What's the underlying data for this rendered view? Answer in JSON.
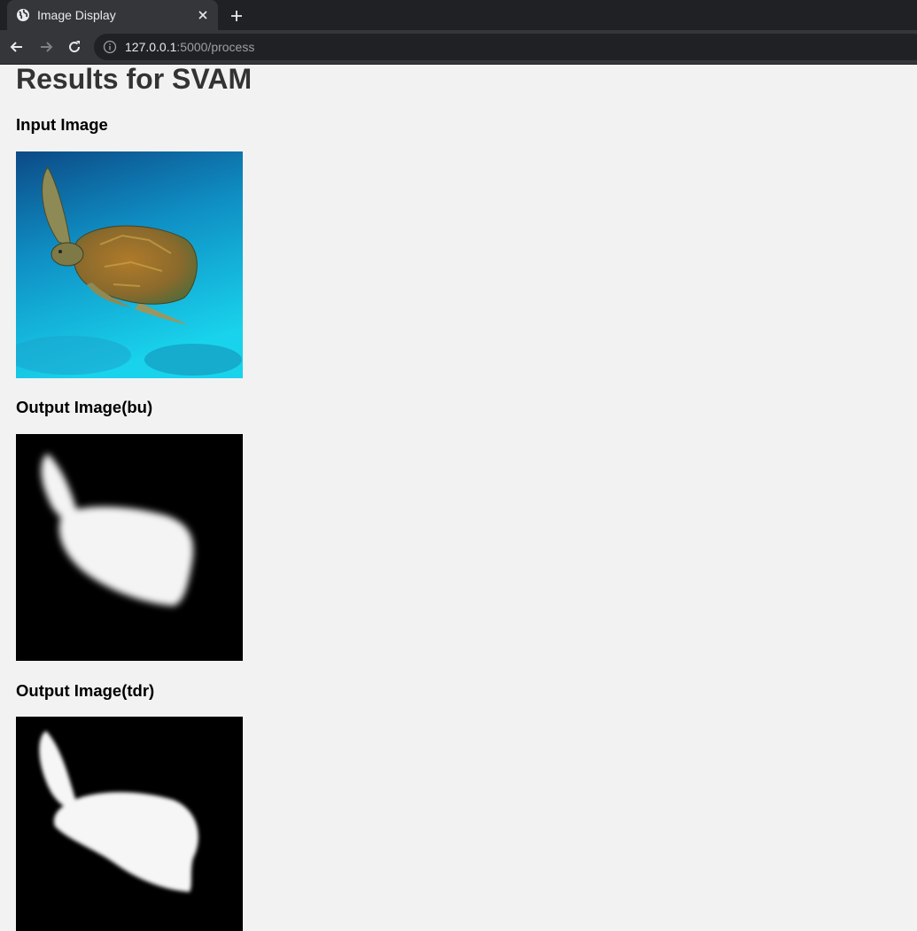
{
  "browser": {
    "tab_title": "Image Display",
    "url_host": "127.0.0.1",
    "url_path": ":5000/process",
    "icons": {
      "favicon": "globe-icon",
      "tab_close": "close-icon",
      "new_tab": "plus-icon",
      "back": "arrow-left-icon",
      "forward": "arrow-right-icon",
      "reload": "reload-icon",
      "site_info": "info-icon"
    }
  },
  "page": {
    "title": "Results for SVAM",
    "sections": [
      {
        "heading": "Input Image"
      },
      {
        "heading": "Output Image(bu)"
      },
      {
        "heading": "Output Image(tdr)"
      }
    ]
  },
  "colors": {
    "page_background": "#f2f2f2",
    "title_text": "#333333",
    "chrome_dark": "#202124",
    "chrome_tab": "#35363a"
  }
}
